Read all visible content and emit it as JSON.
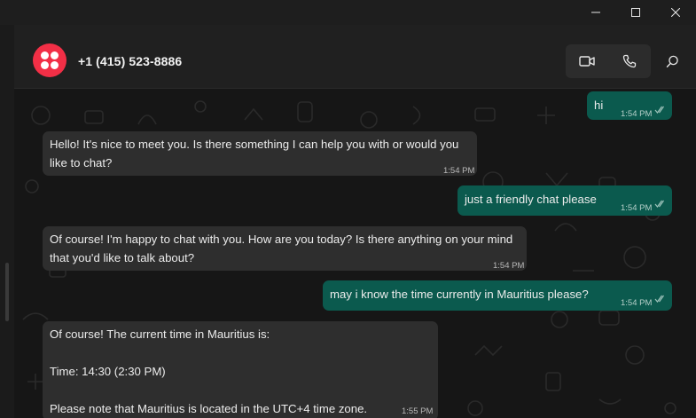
{
  "window": {
    "minimize_icon": "minimize-icon",
    "maximize_icon": "maximize-icon",
    "close_icon": "close-icon"
  },
  "header": {
    "contact_name": "+1 (415) 523-8886",
    "avatar_color": "#f22f46",
    "video_icon": "video-camera-icon",
    "call_icon": "phone-icon",
    "search_icon": "search-icon"
  },
  "colors": {
    "outgoing_bubble": "#0b5a4e",
    "incoming_bubble": "#2e2e2e",
    "chat_background": "#161616",
    "header_background": "#202020"
  },
  "messages": [
    {
      "direction": "outgoing",
      "text": "hi",
      "time": "1:54 PM",
      "status": "read"
    },
    {
      "direction": "incoming",
      "text": "Hello! It's nice to meet you. Is there something I can help you with or would you like to chat?",
      "time": "1:54 PM"
    },
    {
      "direction": "outgoing",
      "text": "just a friendly chat please",
      "time": "1:54 PM",
      "status": "read"
    },
    {
      "direction": "incoming",
      "text": "Of course! I'm happy to chat with you. How are you today? Is there anything on your mind that you'd like to talk about?",
      "time": "1:54 PM"
    },
    {
      "direction": "outgoing",
      "text": "may i know the time currently in Mauritius please?",
      "time": "1:54 PM",
      "status": "read"
    },
    {
      "direction": "incoming",
      "text": "Of course! The current time in Mauritius is:\n\nTime: 14:30 (2:30 PM)\n\nPlease note that Mauritius is located in the UTC+4 time zone.",
      "time": "1:55 PM"
    }
  ]
}
